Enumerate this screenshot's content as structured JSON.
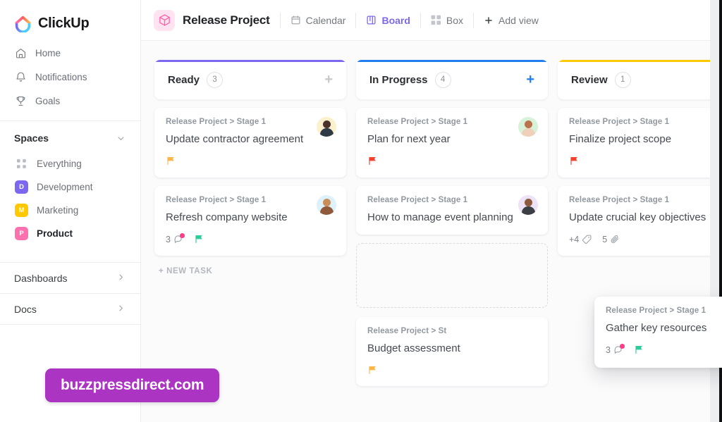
{
  "brand": {
    "name": "ClickUp",
    "accent": "#7b68ee"
  },
  "sidebar": {
    "nav": [
      {
        "label": "Home",
        "icon": "home-icon"
      },
      {
        "label": "Notifications",
        "icon": "bell-icon"
      },
      {
        "label": "Goals",
        "icon": "trophy-icon"
      }
    ],
    "spaces_title": "Spaces",
    "spaces": [
      {
        "label": "Everything",
        "initial": "",
        "color": "",
        "icon": "grid-dots-icon",
        "active": false
      },
      {
        "label": "Development",
        "initial": "D",
        "color": "#7b68ee",
        "icon": "space-badge",
        "active": false
      },
      {
        "label": "Marketing",
        "initial": "M",
        "color": "#ffc800",
        "icon": "space-badge",
        "active": false
      },
      {
        "label": "Product",
        "initial": "P",
        "color": "#fd71af",
        "icon": "space-badge",
        "active": true
      }
    ],
    "footer": [
      {
        "label": "Dashboards"
      },
      {
        "label": "Docs"
      }
    ]
  },
  "header": {
    "project_title": "Release Project",
    "project_icon": "cube-icon",
    "views": [
      {
        "label": "Calendar",
        "icon": "calendar-icon",
        "active": false
      },
      {
        "label": "Board",
        "icon": "board-icon",
        "active": true
      },
      {
        "label": "Box",
        "icon": "box-grid-icon",
        "active": false
      },
      {
        "label": "Add view",
        "icon": "plus-icon",
        "active": false
      }
    ]
  },
  "board": {
    "new_task_label": "+ NEW TASK",
    "columns": [
      {
        "name": "Ready",
        "count": "3",
        "accent": "#7b68ee",
        "add_color": "#c5c8cd",
        "cards": [
          {
            "path": "Release Project > Stage 1",
            "title": "Update contractor agreement",
            "avatar": {
              "bg": "#fdf0cd",
              "skin": "#4a3228",
              "shirt": "#2e3a46"
            },
            "meta": [
              {
                "type": "flag",
                "color": "#ffb648"
              }
            ]
          },
          {
            "path": "Release Project > Stage 1",
            "title": "Refresh company website",
            "avatar": {
              "bg": "#ddf1fb",
              "skin": "#c98d5a",
              "shirt": "#8e5a3a"
            },
            "meta": [
              {
                "type": "comment",
                "count": "3",
                "badge": "#ff3d8b"
              },
              {
                "type": "flag",
                "color": "#2ecc9b"
              }
            ]
          }
        ],
        "show_new_task": true
      },
      {
        "name": "In Progress",
        "count": "4",
        "accent": "#1f7fef",
        "add_color": "#1f7fef",
        "cards": [
          {
            "path": "Release Project > Stage 1",
            "title": "Plan for next year",
            "avatar": {
              "bg": "#d8f2da",
              "skin": "#b9724c",
              "shirt": "#f0cfbb"
            },
            "meta": [
              {
                "type": "flag",
                "color": "#f4412e"
              }
            ]
          },
          {
            "path": "Release Project > Stage 1",
            "title": "How to manage event planning",
            "avatar": {
              "bg": "#eee2f7",
              "skin": "#8c5b3f",
              "shirt": "#3b3f45"
            },
            "meta": []
          },
          {
            "path": "Release Project > St",
            "title": "Budget assessment",
            "avatar": null,
            "meta": [
              {
                "type": "flag",
                "color": "#ffb648"
              }
            ]
          }
        ],
        "show_dropzone": true,
        "show_new_task": false
      },
      {
        "name": "Review",
        "count": "1",
        "accent": "#ffc800",
        "add_color": "#c5c8cd",
        "cards": [
          {
            "path": "Release Project > Stage 1",
            "title": "Finalize project scope",
            "avatar": null,
            "meta": [
              {
                "type": "flag",
                "color": "#f4412e"
              }
            ]
          },
          {
            "path": "Release Project > Stage 1",
            "title": "Update crucial key objectives",
            "avatar": null,
            "meta": [
              {
                "type": "tag",
                "count": "+4"
              },
              {
                "type": "attachment",
                "count": "5"
              }
            ]
          }
        ],
        "show_new_task": false
      }
    ],
    "dragging_card": {
      "path": "Release Project > Stage 1",
      "title": "Gather key resources",
      "avatar": {
        "bg": "#ddf1fb",
        "skin": "#c98d5a",
        "shirt": "#b5703f"
      },
      "meta": [
        {
          "type": "comment",
          "count": "3",
          "badge": "#ff3d8b"
        },
        {
          "type": "flag",
          "color": "#2ecc9b"
        }
      ],
      "cursor_icon": "move-cursor-icon"
    }
  },
  "watermark": {
    "text": "buzzpressdirect.com",
    "color": "#ab34c3"
  }
}
